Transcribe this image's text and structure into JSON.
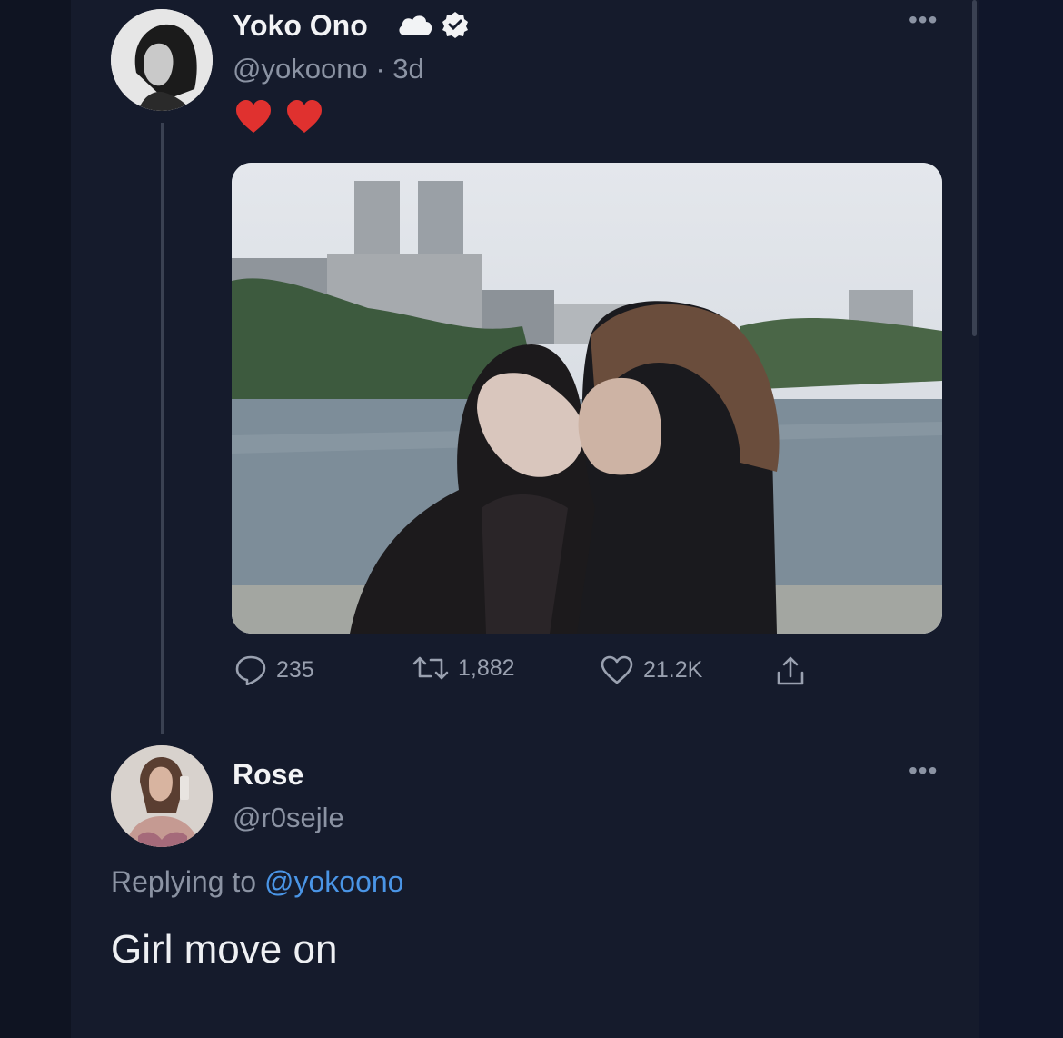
{
  "tweet": {
    "author_name": "Yoko Ono",
    "author_handle": "@yokoono",
    "separator": "·",
    "age": "3d",
    "text_emoji": [
      "heart",
      "heart"
    ],
    "badges": [
      "cloud-icon",
      "verified-badge-icon"
    ],
    "stats": {
      "replies": "235",
      "retweets": "1,882",
      "likes": "21.2K"
    },
    "photo_description_icon": "photo"
  },
  "reply": {
    "author_name": "Rose",
    "author_handle": "@r0sejle",
    "replying_prefix": "Replying to",
    "replying_to": "@yokoono",
    "text": "Girl move on"
  },
  "colors": {
    "background": "#151b2c",
    "text_primary": "#f2f3f5",
    "text_secondary": "#8b93a3",
    "link": "#4a95e6",
    "heart": "#e0312f"
  }
}
